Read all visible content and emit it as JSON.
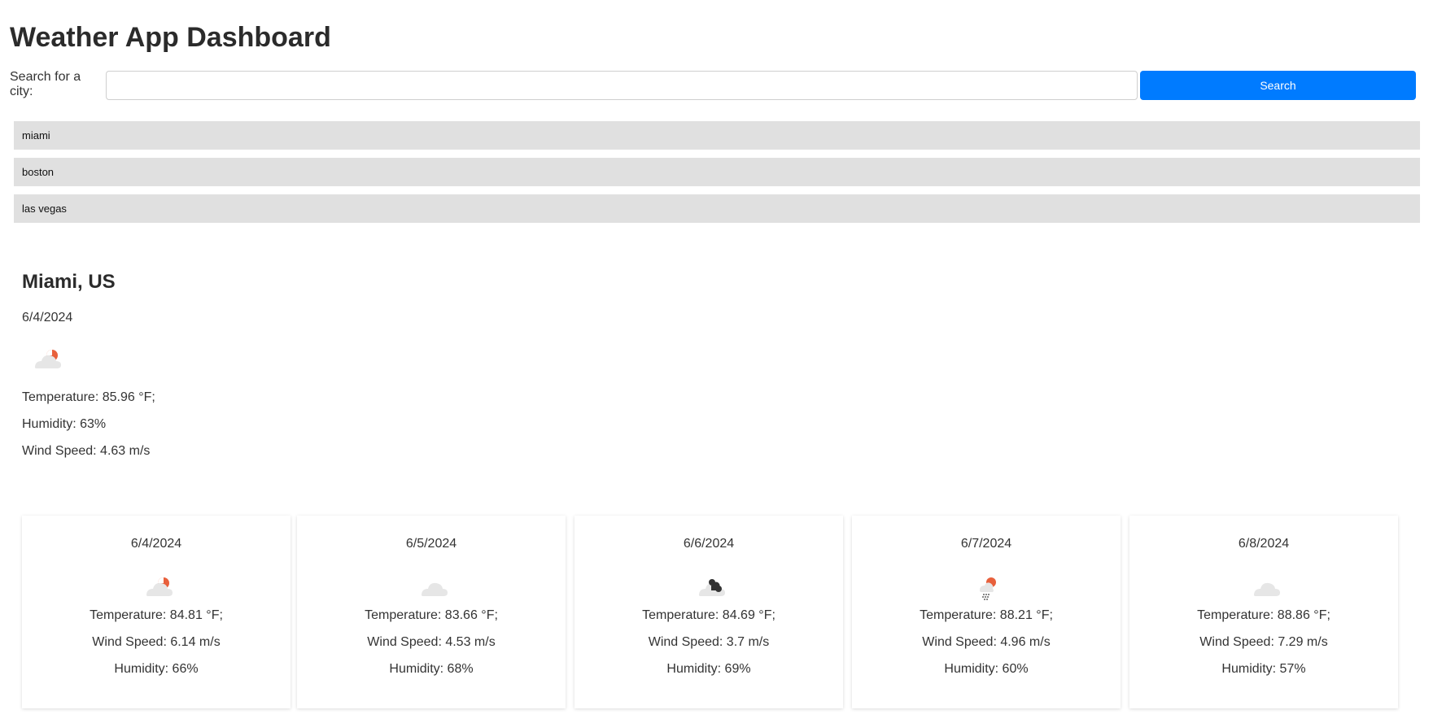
{
  "page_title": "Weather App Dashboard",
  "search": {
    "label": "Search for a city:",
    "value": "",
    "placeholder": "",
    "button_label": "Search"
  },
  "history": [
    {
      "label": "miami"
    },
    {
      "label": "boston"
    },
    {
      "label": "las vegas"
    }
  ],
  "current": {
    "city": "Miami, US",
    "date": "6/4/2024",
    "icon": "partly-cloudy-day-icon",
    "temperature": "Temperature: 85.96 °F;",
    "humidity": "Humidity: 63%",
    "wind": "Wind Speed: 4.63 m/s"
  },
  "forecast": [
    {
      "date": "6/4/2024",
      "icon": "partly-cloudy-day-icon",
      "temperature": "Temperature: 84.81 °F;",
      "wind": "Wind Speed: 6.14 m/s",
      "humidity": "Humidity: 66%"
    },
    {
      "date": "6/5/2024",
      "icon": "cloud-icon",
      "temperature": "Temperature: 83.66 °F;",
      "wind": "Wind Speed: 4.53 m/s",
      "humidity": "Humidity: 68%"
    },
    {
      "date": "6/6/2024",
      "icon": "broken-clouds-icon",
      "temperature": "Temperature: 84.69 °F;",
      "wind": "Wind Speed: 3.7 m/s",
      "humidity": "Humidity: 69%"
    },
    {
      "date": "6/7/2024",
      "icon": "rain-sun-icon",
      "temperature": "Temperature: 88.21 °F;",
      "wind": "Wind Speed: 4.96 m/s",
      "humidity": "Humidity: 60%"
    },
    {
      "date": "6/8/2024",
      "icon": "cloud-icon",
      "temperature": "Temperature: 88.86 °F;",
      "wind": "Wind Speed: 7.29 m/s",
      "humidity": "Humidity: 57%"
    }
  ],
  "colors": {
    "accent": "#007bff",
    "history_bg": "#e0e0e0",
    "sun": "#e8603c",
    "cloud_light": "#e6e6e6",
    "cloud_dark": "#333333"
  }
}
